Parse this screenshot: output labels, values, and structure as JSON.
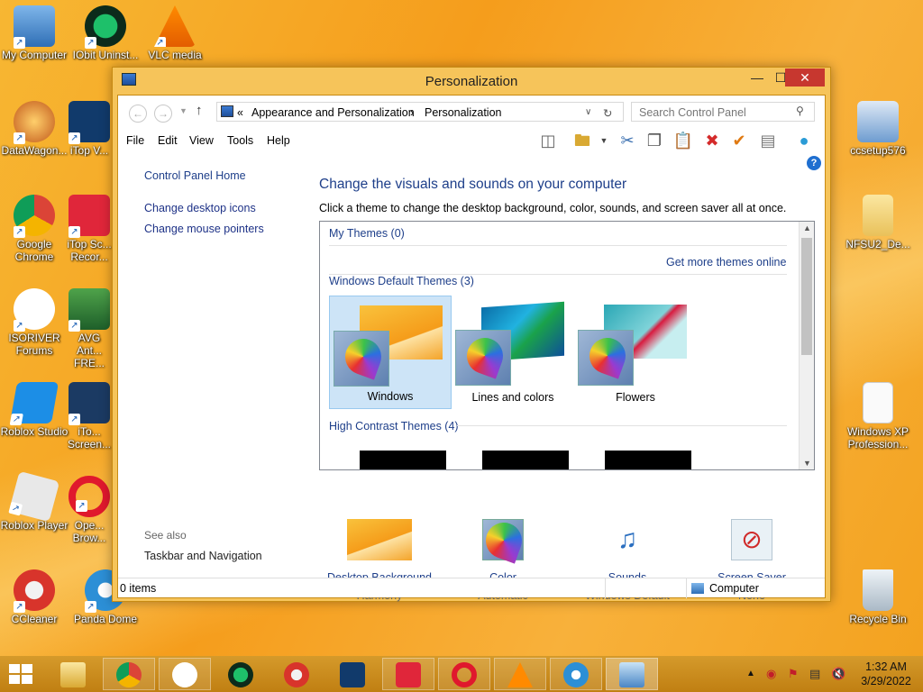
{
  "desktop": {
    "left_icons": [
      {
        "label": "My Computer"
      },
      {
        "label": "IObit Uninst..."
      },
      {
        "label": "VLC media"
      },
      {
        "label": "DataWagon..."
      },
      {
        "label": "iTop V..."
      },
      {
        "label": "Google Chrome"
      },
      {
        "label": "iTop Sc... Recor..."
      },
      {
        "label": "ISORIVER Forums"
      },
      {
        "label": "AVG Ant... FRE..."
      },
      {
        "label": "Roblox Studio"
      },
      {
        "label": "iTo... Screen..."
      },
      {
        "label": "Roblox Player"
      },
      {
        "label": "Ope... Brow..."
      },
      {
        "label": "CCleaner"
      },
      {
        "label": "Panda Dome"
      }
    ],
    "right_icons": [
      {
        "label": "ccsetup576"
      },
      {
        "label": "NFSU2_De..."
      },
      {
        "label": "Windows XP Profession..."
      },
      {
        "label": "Recycle Bin"
      }
    ]
  },
  "window": {
    "title": "Personalization",
    "buttons": {
      "minimize": "—",
      "maximize": "☐",
      "close": "✕"
    },
    "address": {
      "prefix": "«",
      "crumb1": "Appearance and Personalization",
      "sep": "›",
      "crumb2": "Personalization"
    },
    "search_placeholder": "Search Control Panel",
    "menu": [
      "File",
      "Edit",
      "View",
      "Tools",
      "Help"
    ],
    "left_pane": {
      "home": "Control Panel Home",
      "links": [
        "Change desktop icons",
        "Change mouse pointers"
      ],
      "see_also_heading": "See also",
      "see_also": [
        "Taskbar and Navigation"
      ]
    },
    "main": {
      "title": "Change the visuals and sounds on your computer",
      "description": "Click a theme to change the desktop background, color, sounds, and screen saver all at once.",
      "my_themes": "My Themes (0)",
      "get_more": "Get more themes online",
      "default_themes": "Windows Default Themes (3)",
      "themes": [
        {
          "label": "Windows",
          "selected": true
        },
        {
          "label": "Lines and colors",
          "selected": false
        },
        {
          "label": "Flowers",
          "selected": false
        }
      ],
      "high_contrast": "High Contrast Themes (4)"
    },
    "bottom": [
      {
        "title": "Desktop Background",
        "sub": "Harmony"
      },
      {
        "title": "Color",
        "sub": "Automatic"
      },
      {
        "title": "Sounds",
        "sub": "Windows Default"
      },
      {
        "title": "Screen Saver",
        "sub": "None"
      }
    ],
    "status": {
      "items": "0 items",
      "location": "Computer"
    }
  },
  "taskbar": {
    "clock_time": "1:32 AM",
    "clock_date": "3/29/2022"
  },
  "colors": {
    "accent": "#1e3f8a",
    "desktop": "#f4a62a",
    "window_frame": "#f6c45a"
  }
}
